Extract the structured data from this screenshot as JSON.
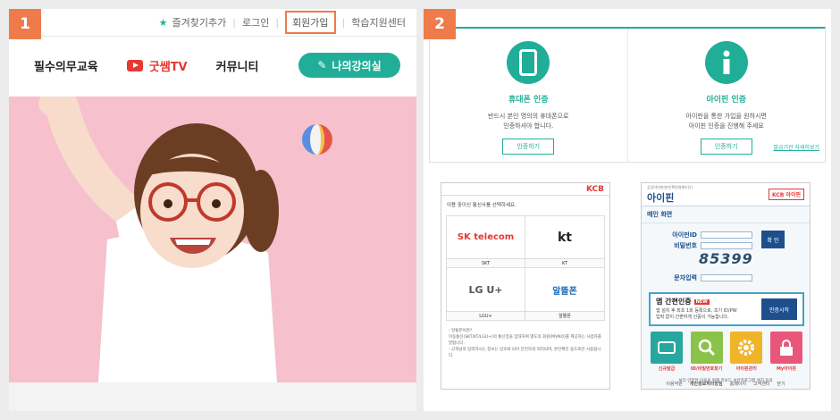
{
  "panel1": {
    "number": "1",
    "topbar": {
      "bookmark": "즐겨찾기추가",
      "login": "로그인",
      "signup": "회원가입",
      "support": "학습지원센터"
    },
    "nav": {
      "item1": "필수의무교육",
      "item2": "굿쌤TV",
      "item3": "커뮤니티",
      "my_class": "나의강의실"
    }
  },
  "panel2": {
    "number": "2",
    "phone_cert": {
      "title": "휴대폰 인증",
      "desc": "반드시 본인 명의의 휴대폰으로\n인증하셔야 합니다.",
      "button": "인증하기"
    },
    "ipin_cert": {
      "title": "아이핀 인증",
      "desc": "아이핀을 통한 가입을 원하시면\n아이핀 인증을 진행해 주세요",
      "button": "인증하기",
      "more": "발급기관 자세히보기"
    },
    "kcb": {
      "brand": "KCB",
      "prompt": "이용 중이신 통신사를 선택하세요.",
      "carriers": [
        {
          "logo": "SK telecom",
          "caption": "SKT"
        },
        {
          "logo": "kt",
          "caption": "KT"
        },
        {
          "logo": "LG U+",
          "caption": "LGU+"
        },
        {
          "logo": "알뜰폰",
          "caption": "알뜰폰"
        }
      ],
      "notes": "- 알뜰폰이란?\n  이동통신(SKT/KT/LGU+)의 통신망을 임대하여 별도의 회원(MVNO)를 제공하는 사업자를 말합니다.\n- 고객님의 입력하시는 정보는 암호화 되어 안전하게 처리되며, 본인확인 용도로만 사용됩니다."
    },
    "ipin": {
      "brand": "아이핀",
      "brand_sub": "공공아이핀(본인확인대체수단)",
      "kcb": "KCB 아이핀",
      "main": "메인 화면",
      "id_label": "아이핀ID",
      "pw_label": "비밀번호",
      "login_btn": "확 인",
      "captcha": "85399",
      "captcha_label": "문자입력",
      "simple_title": "앱 간편인증",
      "new_badge": "NEW",
      "simple_desc": "앱 설치 후 최초 1회 등록으로, 초기 ID/PW\n입력 없이 간편하게 인증이 가능합니다.",
      "simple_btn": "인증시작",
      "tiles": [
        "신규발급",
        "ID/비밀번호찾기",
        "아이핀관리",
        "My아이핀"
      ],
      "agree": "보다 안전한 이용을 위해 키보드 보안프로그램 설치 동의",
      "foot": [
        "이용약관",
        "개인정보처리방침",
        "홈페이지",
        "고객센터",
        "닫기"
      ]
    }
  },
  "colors": {
    "accent": "#21ae98",
    "marker": "#ef7b4b",
    "red": "#e53935",
    "ipin_blue": "#1e4f8c"
  }
}
